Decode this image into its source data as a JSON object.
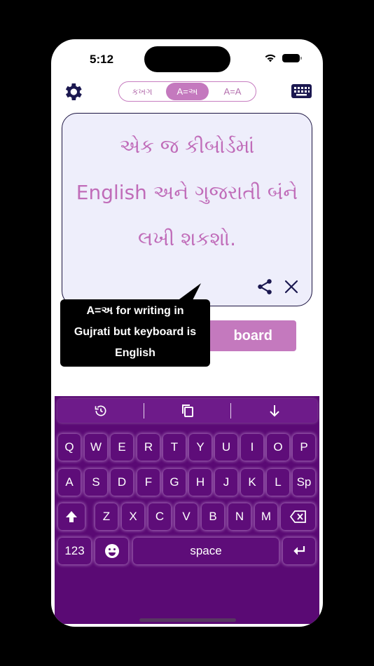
{
  "status": {
    "time": "5:12"
  },
  "mode_toggle": {
    "options": [
      "કખગ",
      "A=અ",
      "A=A"
    ],
    "selected": "A=અ"
  },
  "text_area": {
    "lines": [
      "એક જ કીબોર્ડમાં",
      "English અને ગુજરાતી બંને",
      "લખી શકશો."
    ]
  },
  "action_button": {
    "label_visible": "board"
  },
  "tooltip": {
    "lines": [
      "A=અ for writing in",
      "Gujrati but keyboard is",
      "English"
    ]
  },
  "keyboard": {
    "row1": [
      "Q",
      "W",
      "E",
      "R",
      "T",
      "Y",
      "U",
      "I",
      "O",
      "P"
    ],
    "row2": [
      "A",
      "S",
      "D",
      "F",
      "G",
      "H",
      "J",
      "K",
      "L",
      "Sp"
    ],
    "row3": [
      "Z",
      "X",
      "C",
      "V",
      "B",
      "N",
      "M"
    ],
    "numbers_key": "123",
    "space_key": "space"
  },
  "colors": {
    "accent": "#c479be",
    "keyboard_bg": "#5a0a74",
    "textbox_bg": "#eeeefb"
  }
}
